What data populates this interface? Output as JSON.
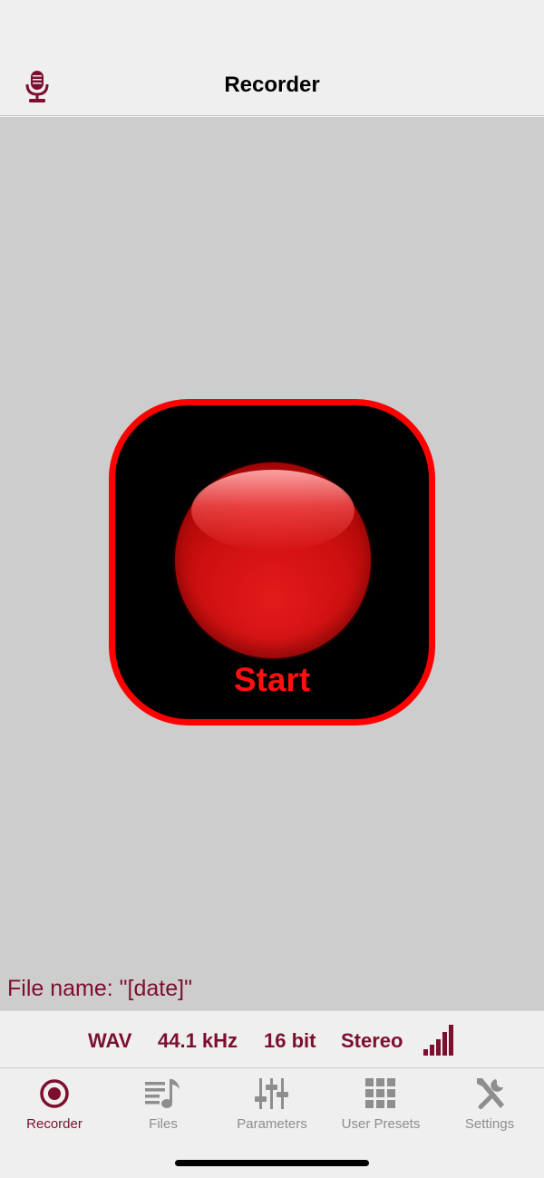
{
  "header": {
    "title": "Recorder",
    "icon": "microphone-icon"
  },
  "record_button": {
    "label": "Start",
    "icon": "record-ball-icon"
  },
  "file_name": "File name: \"[date]\"",
  "status": {
    "format": "WAV",
    "sample_rate": "44.1 kHz",
    "bit_depth": "16 bit",
    "channels": "Stereo",
    "level_icon": "signal-bars-icon"
  },
  "tabs": [
    {
      "label": "Recorder",
      "icon": "record-icon",
      "active": true
    },
    {
      "label": "Files",
      "icon": "music-list-icon",
      "active": false
    },
    {
      "label": "Parameters",
      "icon": "sliders-icon",
      "active": false
    },
    {
      "label": "User Presets",
      "icon": "grid-icon",
      "active": false
    },
    {
      "label": "Settings",
      "icon": "tools-icon",
      "active": false
    }
  ],
  "colors": {
    "accent": "#7d0f2e",
    "record_red": "#ff0000",
    "inactive_tab": "#8e8e8e",
    "main_bg": "#cdcdcd"
  }
}
